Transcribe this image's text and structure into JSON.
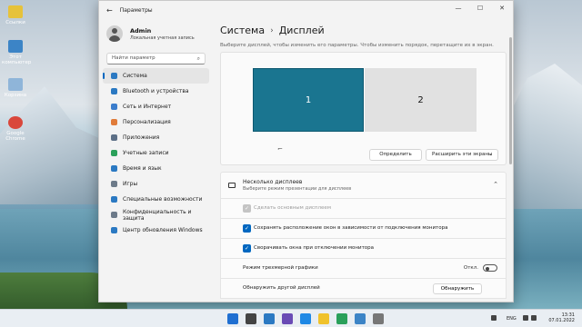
{
  "window": {
    "title": "Параметры",
    "controls": {
      "minimize": "—",
      "maximize": "☐",
      "close": "✕"
    }
  },
  "desktop_icons": [
    {
      "label": "Ссылки",
      "color": "#e6c23b"
    },
    {
      "label": "Этот компьютер",
      "color": "#3c84c6"
    },
    {
      "label": "Корзина",
      "color": "#8fb5d9"
    },
    {
      "label": "Google Chrome",
      "color": "#d9473b"
    }
  ],
  "profile": {
    "name": "Admin",
    "account": "Локальная учетная запись"
  },
  "search": {
    "placeholder": "Найти параметр"
  },
  "nav": [
    {
      "label": "Система",
      "icon": "monitor-icon",
      "color": "#2b79c2",
      "active": true
    },
    {
      "label": "Bluetooth и устройства",
      "icon": "bluetooth-icon",
      "color": "#2b79c2"
    },
    {
      "label": "Сеть и Интернет",
      "icon": "wifi-icon",
      "color": "#3b7dcc"
    },
    {
      "label": "Персонализация",
      "icon": "brush-icon",
      "color": "#e07b39"
    },
    {
      "label": "Приложения",
      "icon": "apps-icon",
      "color": "#5c6f86"
    },
    {
      "label": "Учетные записи",
      "icon": "person-icon",
      "color": "#2aa05a"
    },
    {
      "label": "Время и язык",
      "icon": "globe-icon",
      "color": "#2b79c2"
    },
    {
      "label": "Игры",
      "icon": "gamepad-icon",
      "color": "#6c7a89"
    },
    {
      "label": "Специальные возможности",
      "icon": "accessibility-icon",
      "color": "#2b79c2"
    },
    {
      "label": "Конфиденциальность и защита",
      "icon": "shield-icon",
      "color": "#6c7a89"
    },
    {
      "label": "Центр обновления Windows",
      "icon": "update-icon",
      "color": "#2b79c2"
    }
  ],
  "breadcrumb": {
    "parent": "Система",
    "current": "Дисплей"
  },
  "hint": "Выберите дисплей, чтобы изменить его параметры. Чтобы изменить порядок, перетащите их в экран.",
  "monitors": {
    "first": "1",
    "second": "2"
  },
  "buttons": {
    "identify": "Определить",
    "extend": "Расширить эти экраны",
    "detect": "Обнаружить"
  },
  "multi_display": {
    "title": "Несколько дисплеев",
    "subtitle": "Выберите режим презентации для дисплеев",
    "options": [
      {
        "label": "Сделать основным дисплеем",
        "state": "disabled"
      },
      {
        "label": "Сохранять расположение окон в зависимости от подключения монитора",
        "state": "checked"
      },
      {
        "label": "Сворачивать окна при отключении монитора",
        "state": "checked"
      }
    ],
    "hdr_label": "Режим трехмерной графики",
    "hdr_value": "Откл.",
    "detect_label": "Обнаружить другой дисплей"
  },
  "taskbar": {
    "lang": "ENG",
    "time": "13:31",
    "date": "07.01.2022",
    "apps": [
      "#1f6fd1",
      "#444",
      "#2b79c2",
      "#6a4bb5",
      "#1e88e5",
      "#f0c22c",
      "#2aa05a",
      "#3c84c6",
      "#777"
    ]
  }
}
